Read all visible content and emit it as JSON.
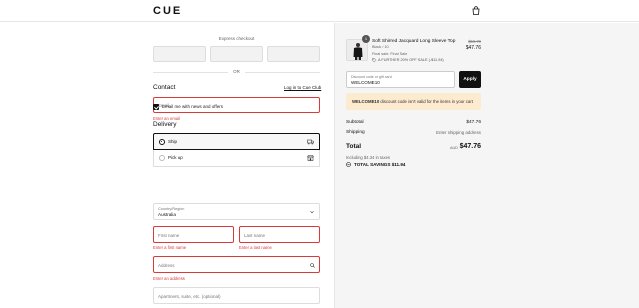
{
  "header": {
    "logo": "CUE",
    "bag_icon": "shopping-bag-icon"
  },
  "checkout": {
    "express_label": "Express checkout",
    "or_label": "OR",
    "contact": {
      "heading": "Contact",
      "login_link": "Log in to Cue Club",
      "email_placeholder": "Email",
      "email_error": "Enter an email",
      "newsletter_label": "Email me with news and offers",
      "newsletter_checked": true
    },
    "delivery": {
      "heading": "Delivery",
      "options": [
        {
          "label": "Ship",
          "selected": true,
          "icon": "truck-icon"
        },
        {
          "label": "Pick up",
          "selected": false,
          "icon": "store-icon"
        }
      ],
      "country_label": "Country/Region",
      "country_value": "Australia",
      "first_name_placeholder": "First name",
      "first_name_error": "Enter a first name",
      "last_name_placeholder": "Last name",
      "last_name_error": "Enter a last name",
      "address_placeholder": "Address",
      "address_error": "Enter an address",
      "apartment_placeholder": "Apartment, suite, etc. (optional)"
    }
  },
  "summary": {
    "item": {
      "qty": "1",
      "name": "Soft Shirred Jacquard Long Sleeve Top",
      "variant": "Black / 10",
      "final_sale": "Final sale: Final Sale",
      "promo": "A FURTHER 20% OFF SALE (-$11.94)",
      "old_price": "$59.70",
      "new_price": "$47.76"
    },
    "discount_label": "Discount code or gift card",
    "discount_value": "WELCOME10",
    "apply_label": "Apply",
    "notice_code": "WELCOME10",
    "notice_rest": " discount code isn't valid for the items in your cart",
    "subtotal_label": "Subtotal",
    "subtotal_value": "$47.76",
    "shipping_label": "Shipping",
    "shipping_value": "Enter shipping address",
    "total_label": "Total",
    "total_currency": "AUD",
    "total_value": "$47.76",
    "taxes": "Including $4.34 in taxes",
    "savings": "TOTAL SAVINGS $11.94"
  },
  "colors": {
    "error": "#d93a3a",
    "notice_bg": "#fdebd0",
    "accent": "#111111"
  }
}
